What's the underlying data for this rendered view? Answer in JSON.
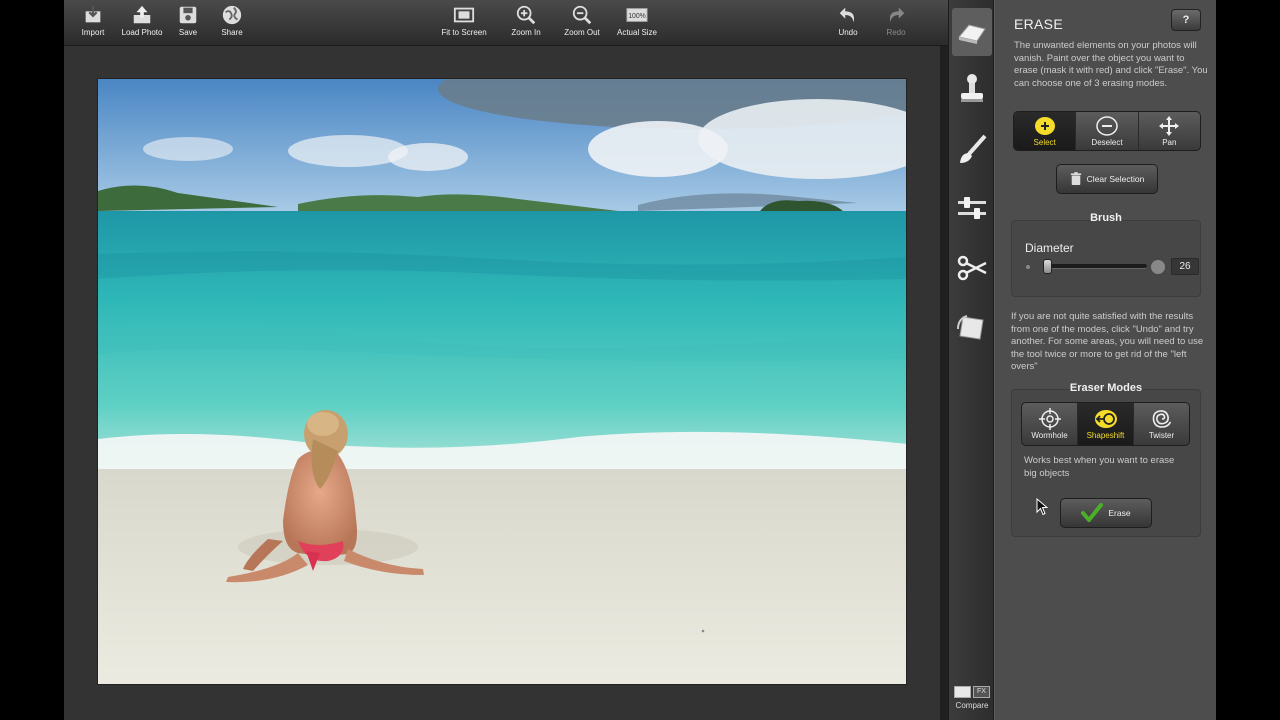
{
  "toolbar": {
    "import": "Import",
    "load_photo": "Load Photo",
    "save": "Save",
    "share": "Share",
    "fit_to_screen": "Fit to Screen",
    "zoom_in": "Zoom In",
    "zoom_out": "Zoom Out",
    "actual_size": "Actual Size",
    "actual_size_icon_text": "100%",
    "undo": "Undo",
    "redo": "Redo"
  },
  "tools": {
    "items": [
      {
        "name": "eraser-icon",
        "active": true
      },
      {
        "name": "stamp-icon",
        "active": false
      },
      {
        "name": "brush-icon",
        "active": false
      },
      {
        "name": "adjust-sliders-icon",
        "active": false
      },
      {
        "name": "scissors-icon",
        "active": false
      },
      {
        "name": "crop-rotate-icon",
        "active": false
      }
    ],
    "compare_label": "Compare",
    "compare_fx": "FX"
  },
  "panel": {
    "title": "ERASE",
    "help_label": "?",
    "intro": "The unwanted elements on your photos will vanish. Paint over the object you want to erase (mask it with red) and click \"Erase\". You can choose one of 3 erasing modes.",
    "select_modes": [
      {
        "label": "Select",
        "icon": "plus-blob-icon",
        "active": true
      },
      {
        "label": "Deselect",
        "icon": "minus-blob-icon",
        "active": false
      },
      {
        "label": "Pan",
        "icon": "move-arrows-icon",
        "active": false
      }
    ],
    "clear_selection": "Clear Selection",
    "brush_title": "Brush",
    "diameter_label": "Diameter",
    "diameter_value": "26",
    "tip": "If you are not quite satisfied with the results from one of the modes, click \"Undo\" and try another. For some areas, you will need to use the tool twice or more to get rid of the \"left overs\"",
    "eraser_modes_title": "Eraser Modes",
    "eraser_modes": [
      {
        "label": "Wormhole",
        "icon": "crosshair-icon",
        "active": false
      },
      {
        "label": "Shapeshift",
        "icon": "shapeshift-icon",
        "active": true
      },
      {
        "label": "Twister",
        "icon": "spiral-icon",
        "active": false
      }
    ],
    "mode_description": "Works best when you want to erase big objects",
    "erase_button": "Erase"
  },
  "colors": {
    "accent_yellow": "#f3dd2a",
    "panel_bg": "#4d4d4d",
    "toolbar_bg": "#2b2b2b",
    "erase_check": "#4caf2a"
  }
}
